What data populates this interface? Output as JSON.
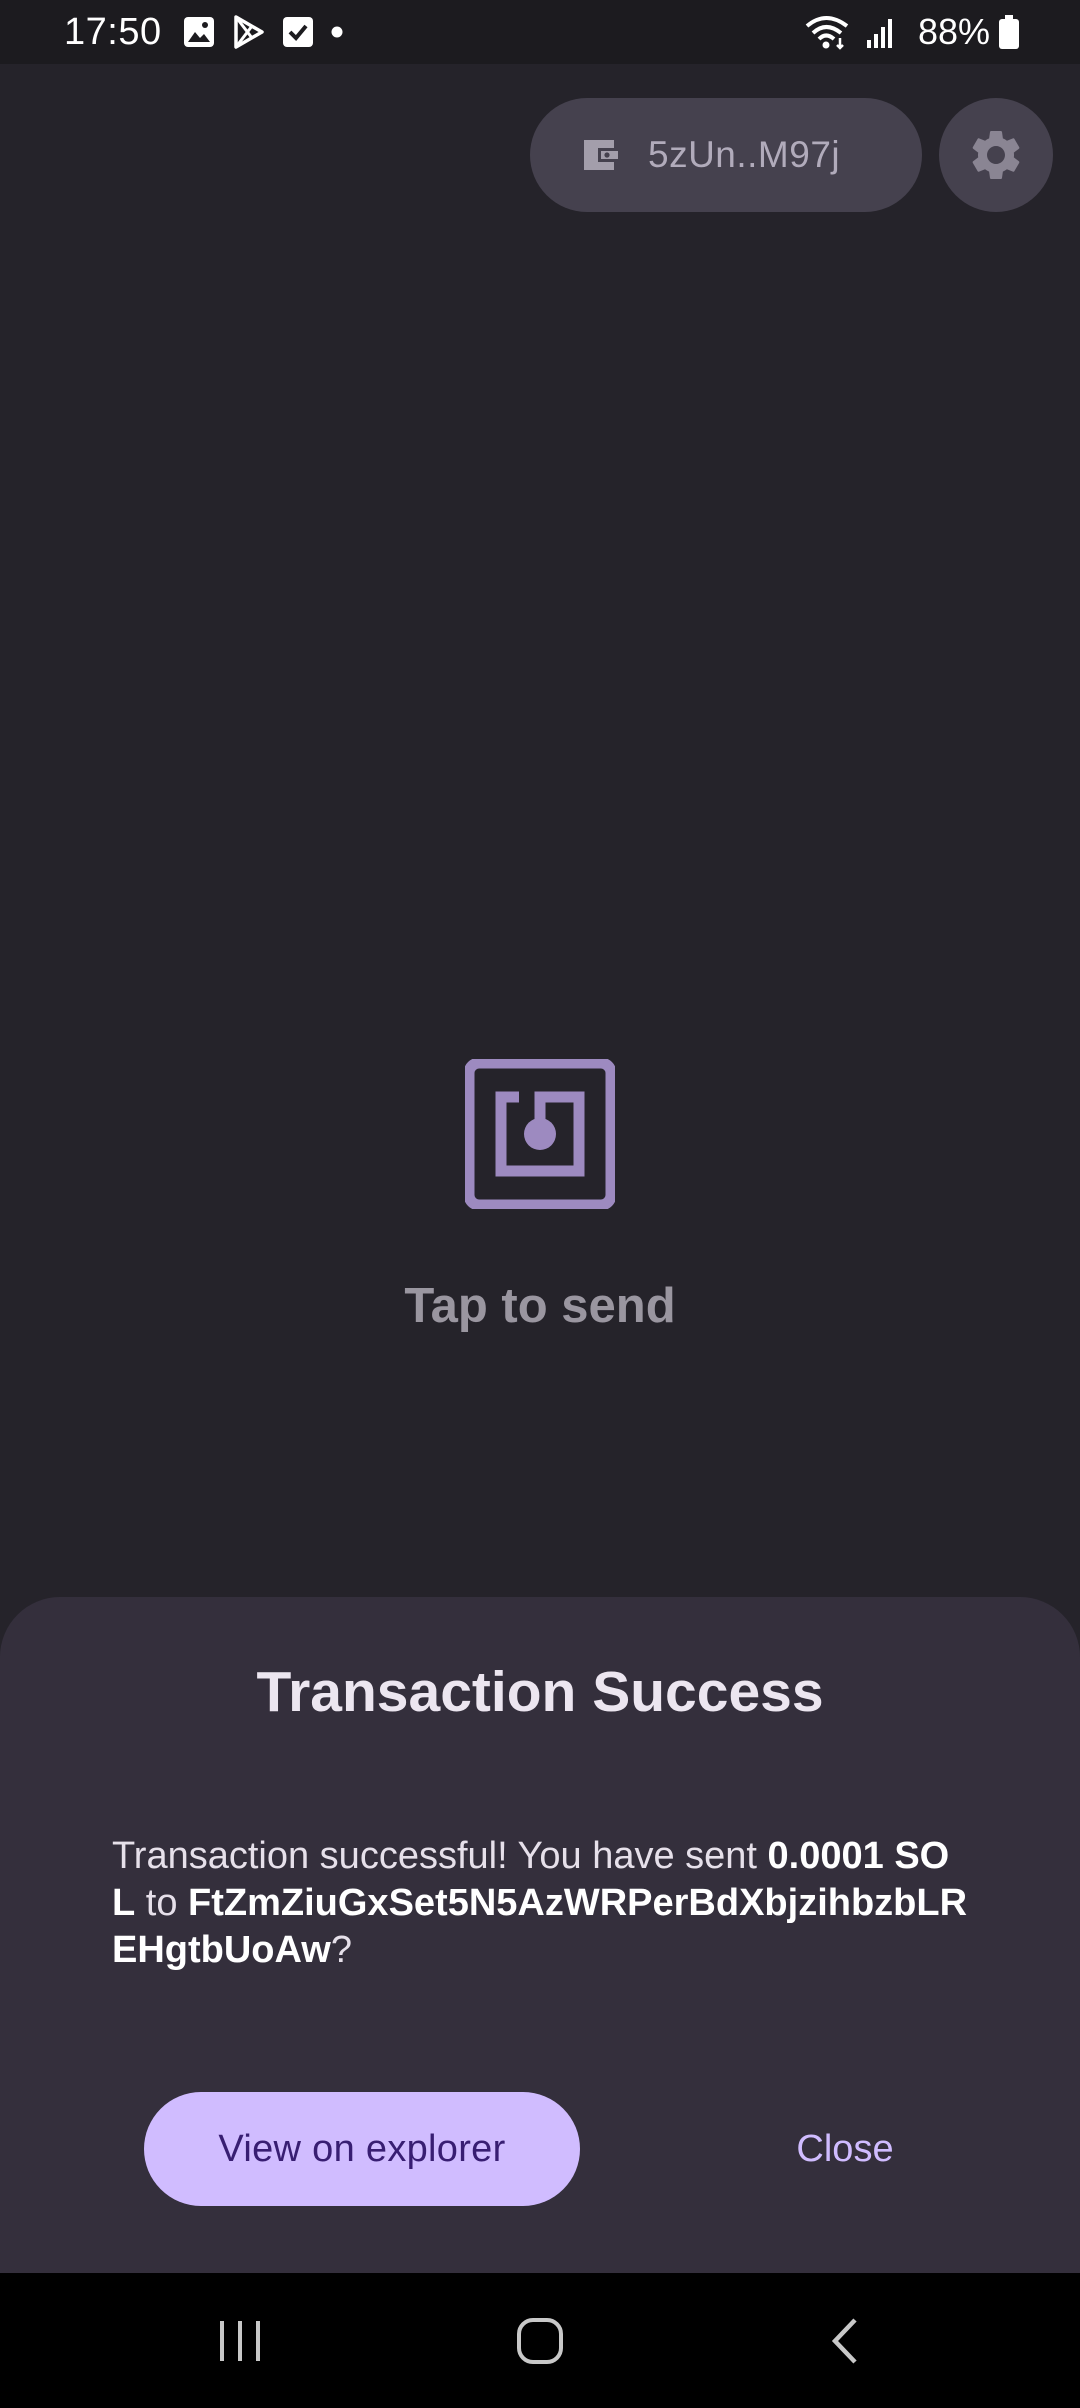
{
  "status_bar": {
    "time": "17:50",
    "battery_percent": "88%",
    "icons": [
      "image-icon",
      "play-store-icon",
      "checkbox-icon",
      "dot-icon",
      "wifi-icon",
      "signal-icon",
      "battery-icon"
    ]
  },
  "header": {
    "wallet_label": "5zUn..M97j",
    "wallet_icon": "wallet-icon",
    "settings_icon": "gear-icon"
  },
  "center": {
    "icon": "nfc-icon",
    "tap_label": "Tap to send"
  },
  "dialog": {
    "title": "Transaction Success",
    "message_prefix": "Transaction successful! You have sent ",
    "amount": "0.0001 SOL",
    "message_mid": " to ",
    "recipient": "FtZmZiuGxSet5N5AzWRPerBdXbjzihbzbLREHgtbUoAw",
    "message_suffix": "?",
    "primary_button": "View on explorer",
    "secondary_button": "Close"
  },
  "colors": {
    "background": "#25232a",
    "sheet": "#342f3c",
    "accent": "#d0bcff",
    "on_accent": "#381e72",
    "icon_purple": "#9d8ac0"
  }
}
